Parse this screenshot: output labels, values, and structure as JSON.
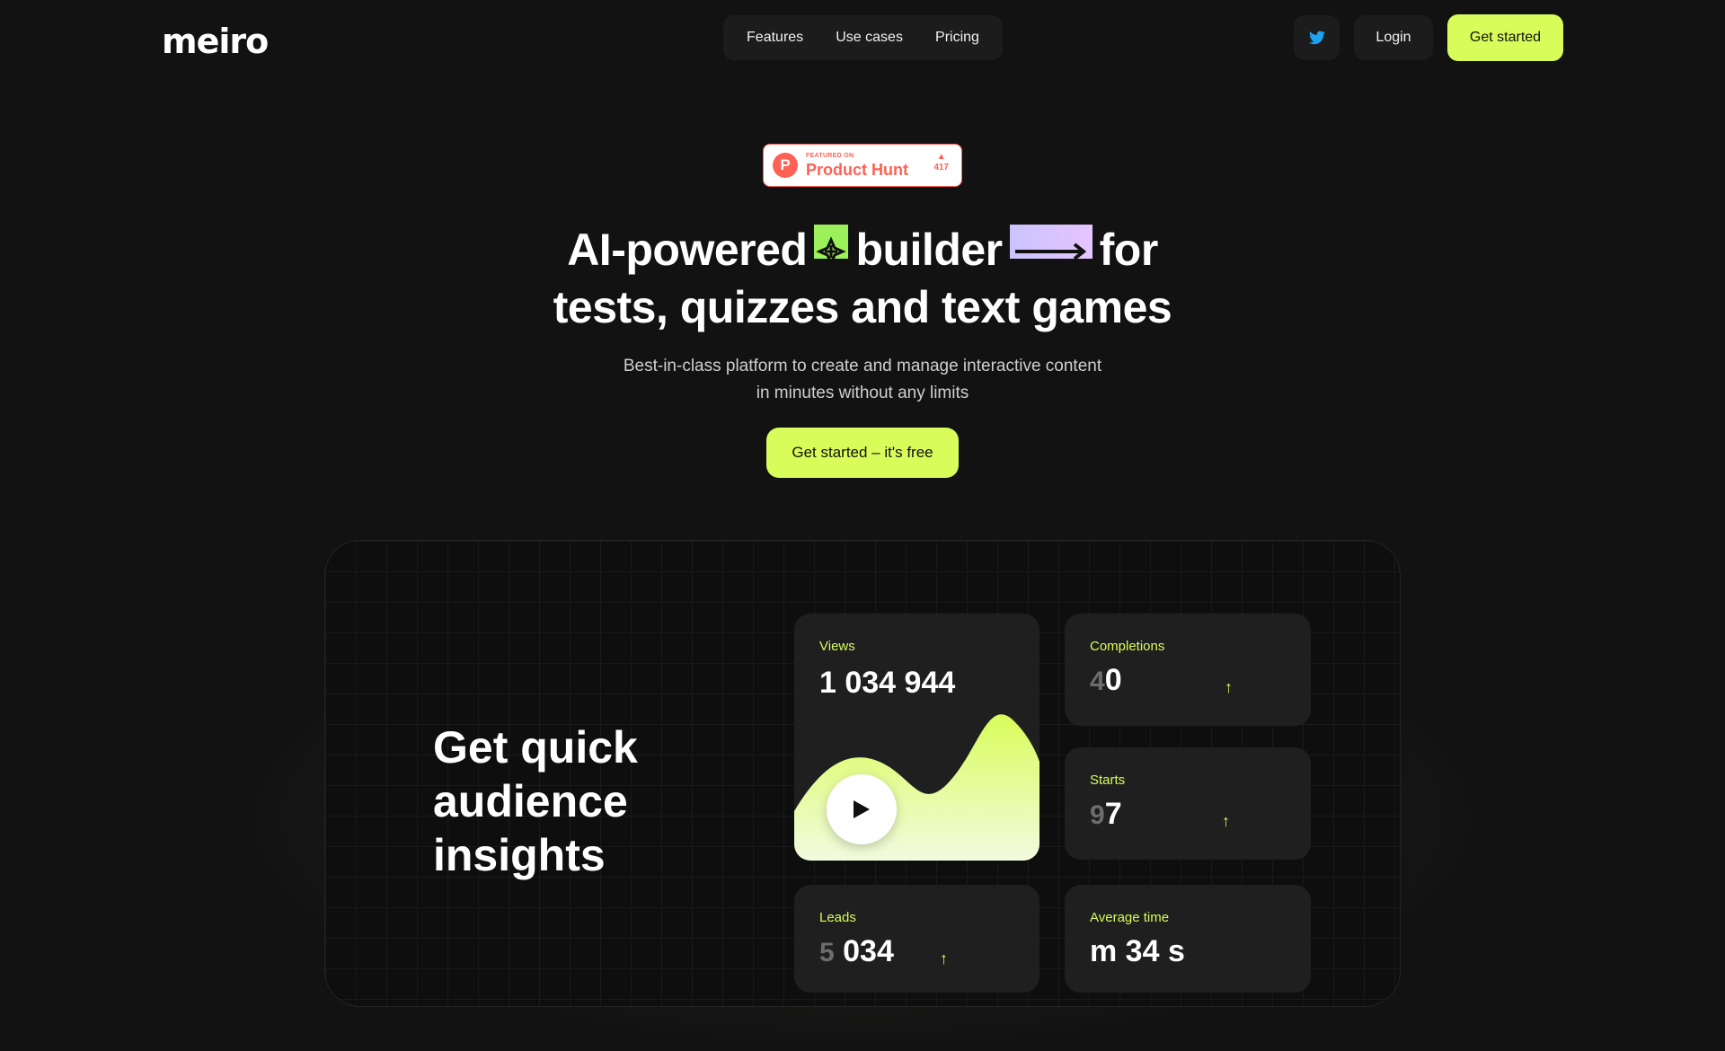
{
  "header": {
    "logo": "meiro",
    "nav": [
      "Features",
      "Use cases",
      "Pricing"
    ],
    "login": "Login",
    "get_started": "Get started"
  },
  "product_hunt": {
    "featured_on": "FEATURED ON",
    "name": "Product Hunt",
    "votes": "417"
  },
  "hero": {
    "title_part1": "AI-powered",
    "title_part2": "builder",
    "title_part3": "for",
    "title_line2": "tests, quizzes and text games",
    "subtitle_line1": "Best-in-class platform to create and manage interactive content",
    "subtitle_line2": "in minutes without any limits",
    "cta": "Get started – it's free"
  },
  "insights": {
    "heading": "Get quick audience insights",
    "cards": {
      "views": {
        "label": "Views",
        "value": "1 034 944"
      },
      "completions": {
        "label": "Completions",
        "ghost": "4",
        "value": "0"
      },
      "starts": {
        "label": "Starts",
        "ghost": "9",
        "value": "7"
      },
      "leads": {
        "label": "Leads",
        "ghost": "5",
        "value": "034"
      },
      "avg_time": {
        "label": "Average time",
        "value": "m 34 s"
      }
    }
  },
  "colors": {
    "accent": "#d8fc5a",
    "background": "#121212",
    "card": "#1f1f1f"
  }
}
